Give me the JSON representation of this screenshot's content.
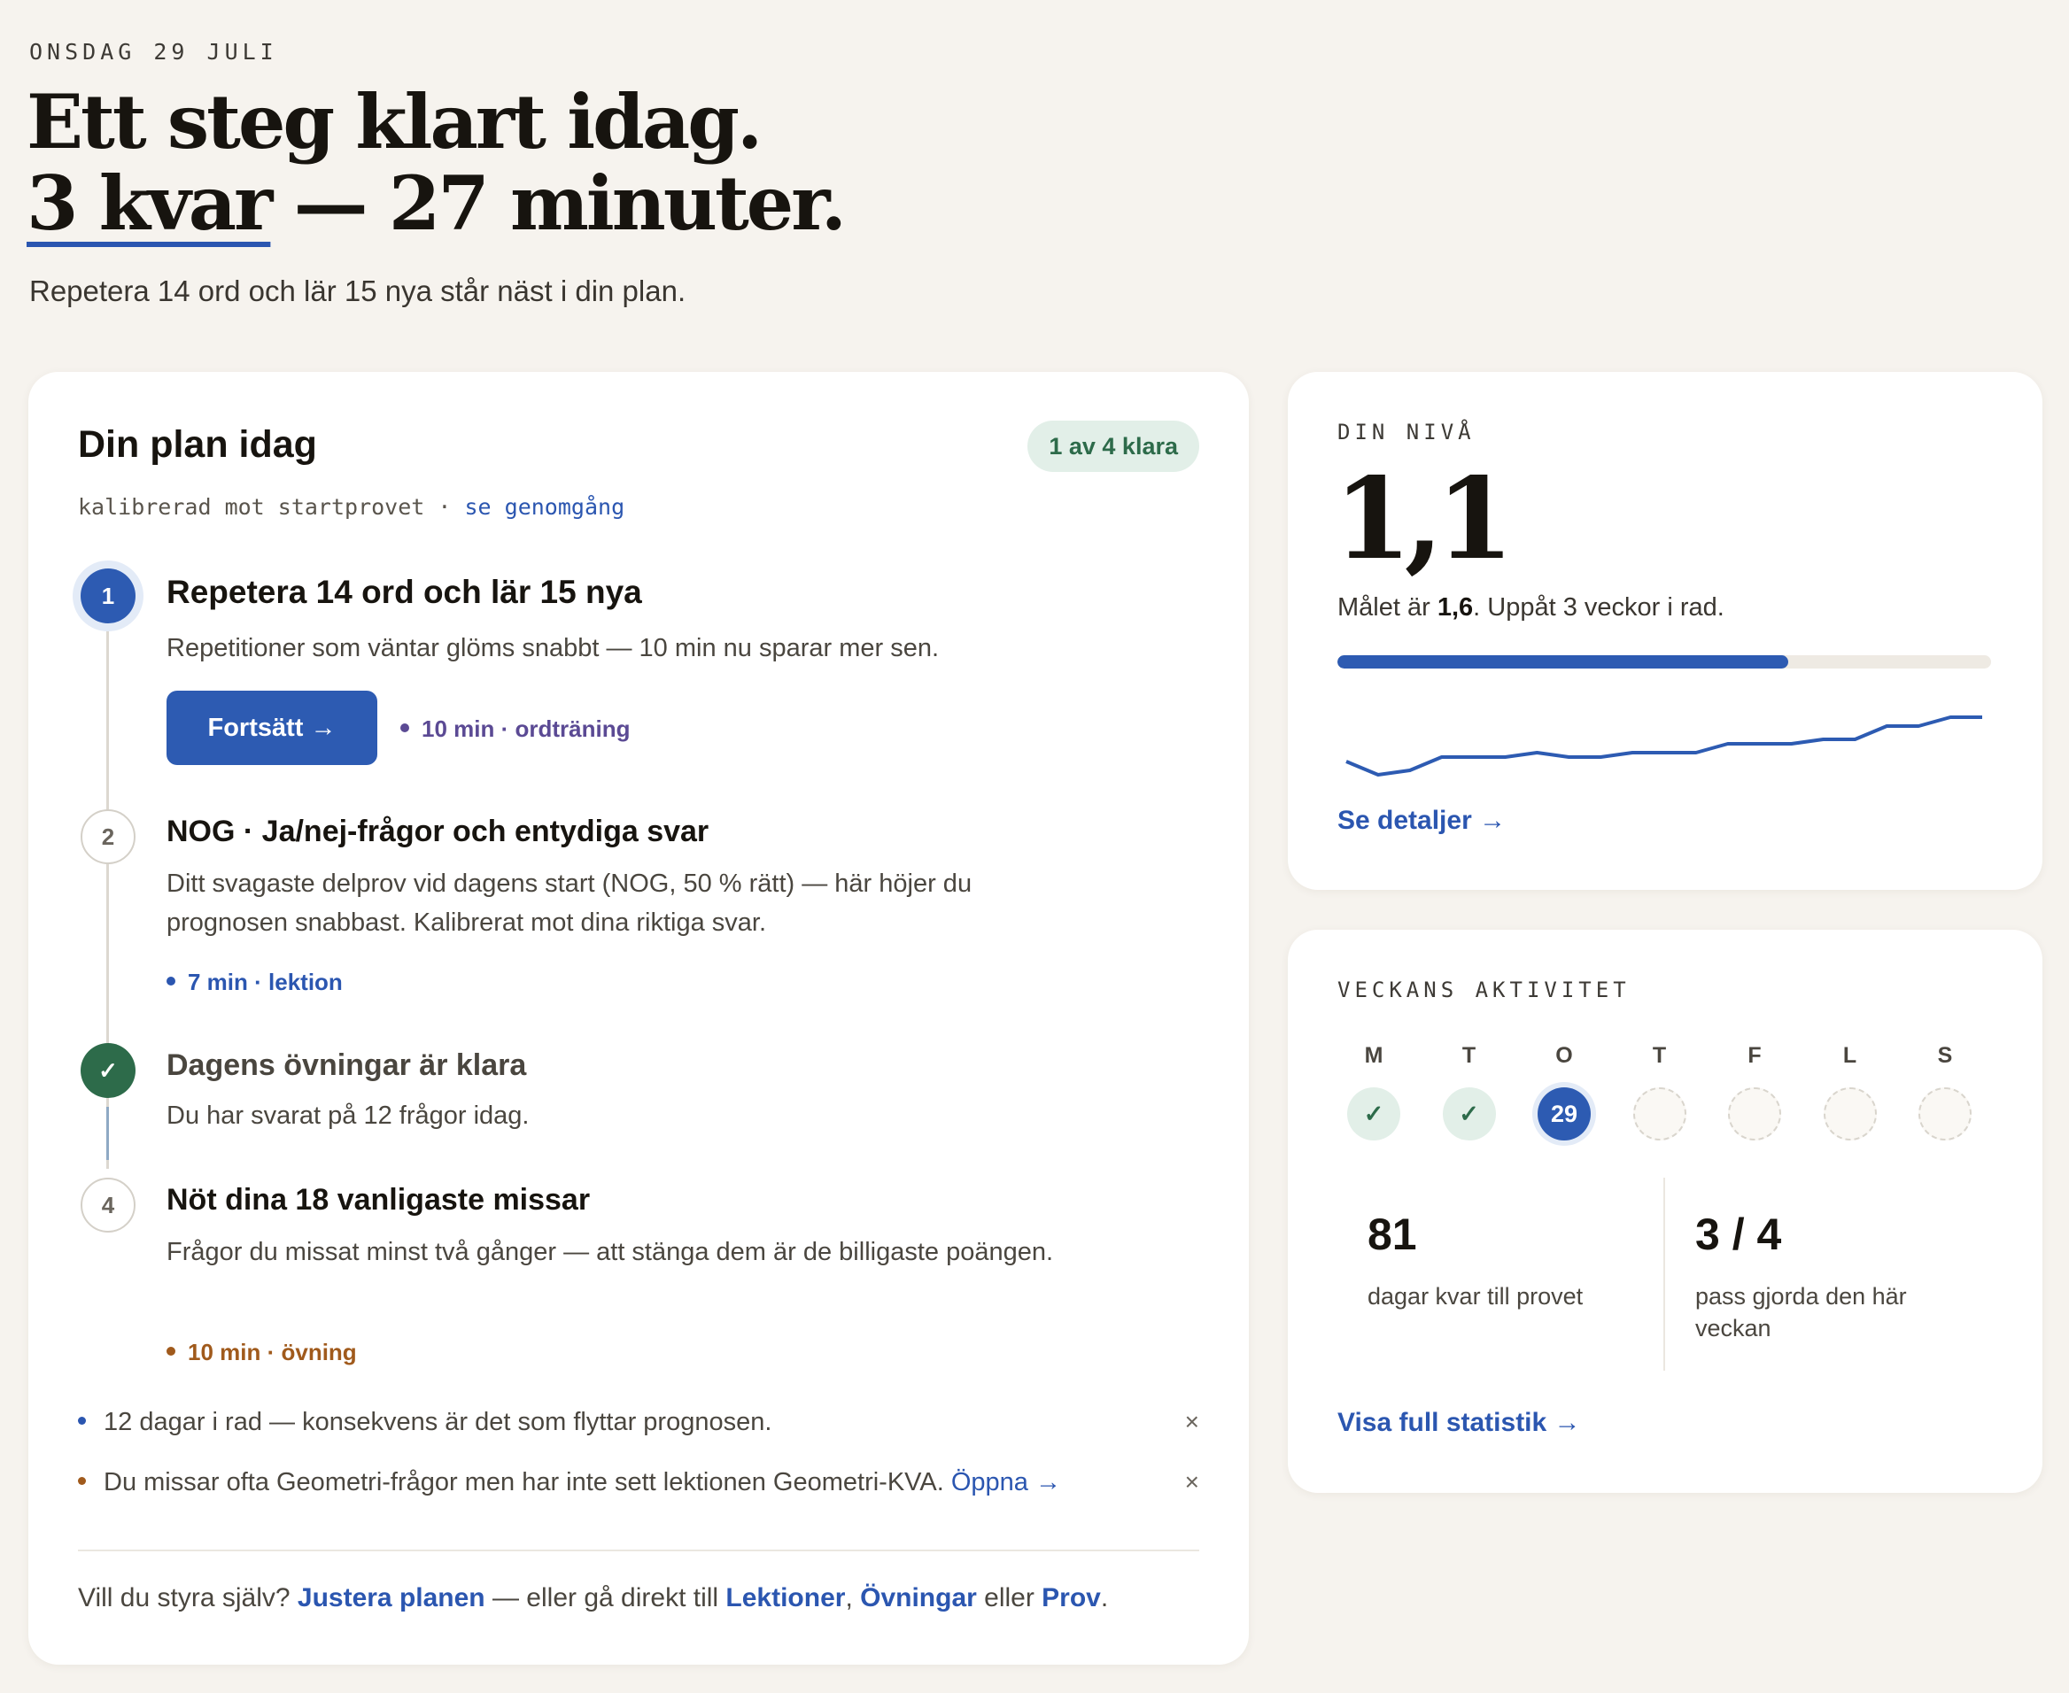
{
  "header": {
    "date": "ONSDAG 29 JULI",
    "headline_line1": "Ett steg klart idag.",
    "headline_remaining": "3 kvar",
    "headline_rest": " — 27 minuter.",
    "lead": "Repetera 14 ord och lär 15 nya står näst i din plan."
  },
  "plan": {
    "title": "Din plan idag",
    "badge": "1 av 4 klara",
    "subtitle": "kalibrerad mot startprovet · ",
    "subtitle_link": "se genomgång",
    "steps": [
      {
        "num": "1",
        "title": "Repetera 14 ord och lär 15 nya",
        "desc": "Repetitioner som väntar glöms snabbt — 10 min nu sparar mer sen.",
        "button": "Fortsätt →",
        "meta": "10 min · ordträning",
        "meta_color": "#5b4a94"
      },
      {
        "num": "2",
        "title": "NOG · Ja/nej-frågor och entydiga svar",
        "desc": "Ditt svagaste delprov vid dagens start (NOG, 50 % rätt) — här höjer du prognosen snabbast. Kalibrerat mot dina riktiga svar.",
        "meta": "7 min · lektion",
        "meta_color": "#2b56b0"
      },
      {
        "num": "✓",
        "title": "Dagens övningar är klara",
        "desc": "Du har svarat på 12 frågor idag."
      },
      {
        "num": "4",
        "title": "Nöt dina 18 vanligaste missar",
        "desc": "Frågor du missat minst två gånger — att stänga dem är de billigaste poängen.",
        "meta": "10 min · övning",
        "meta_color": "#a05a1c"
      }
    ],
    "notes": [
      {
        "text": "12 dagar i rad — konsekvens är det som flyttar prognosen.",
        "dot_color": "#2b56b0"
      },
      {
        "text": "Du missar ofta Geometri-frågor men har inte sett lektionen Geometri-KVA. ",
        "link": "Öppna →",
        "dot_color": "#a05a1c"
      }
    ],
    "close_icon": "×",
    "footer": {
      "prefix": "Vill du styra själv? ",
      "adjust": "Justera planen",
      "middle": " — eller gå direkt till ",
      "lessons": "Lektioner",
      "comma": ", ",
      "exercises": "Övningar",
      "or": " eller ",
      "tests": "Prov",
      "end": "."
    }
  },
  "level": {
    "eyebrow": "DIN NIVÅ",
    "value": "1,1",
    "goal_prefix": "Målet är ",
    "goal_value": "1,6",
    "goal_suffix": ". Uppåt 3 veckor i rad.",
    "progress": 0.69,
    "sparkline": [
      0.82,
      0.79,
      0.8,
      0.83,
      0.83,
      0.83,
      0.84,
      0.83,
      0.83,
      0.84,
      0.84,
      0.84,
      0.86,
      0.86,
      0.86,
      0.87,
      0.87,
      0.9,
      0.9,
      0.92,
      0.92
    ],
    "link": "Se detaljer →",
    "accent": "#2d5bb2"
  },
  "week": {
    "eyebrow": "VECKANS AKTIVITET",
    "days": [
      {
        "label": "M",
        "state": "done",
        "text": "✓"
      },
      {
        "label": "T",
        "state": "done",
        "text": "✓"
      },
      {
        "label": "O",
        "state": "today",
        "text": "29"
      },
      {
        "label": "T",
        "state": "empty",
        "text": ""
      },
      {
        "label": "F",
        "state": "empty",
        "text": ""
      },
      {
        "label": "L",
        "state": "empty",
        "text": ""
      },
      {
        "label": "S",
        "state": "empty",
        "text": ""
      }
    ],
    "stat1_value": "81",
    "stat1_label": "dagar kvar till provet",
    "stat2_value": "3 / 4",
    "stat2_label": "pass gjorda den här veckan",
    "link": "Visa full statistik →"
  }
}
